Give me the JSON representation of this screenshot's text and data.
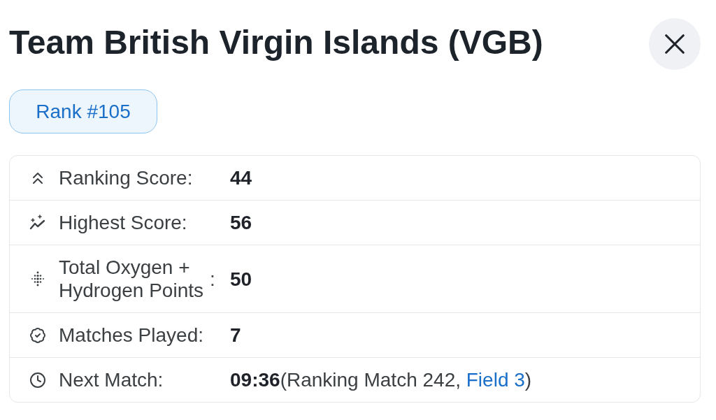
{
  "title": "Team British Virgin Islands (VGB)",
  "rank_badge": "Rank #105",
  "stats": [
    {
      "kind": "number",
      "label": "Ranking Score:",
      "value": "44"
    },
    {
      "kind": "number",
      "label": "Highest Score:",
      "value": "56"
    },
    {
      "kind": "number",
      "label": "Total Oxygen + Hydrogen Points",
      "separator": ":",
      "value": "50"
    },
    {
      "kind": "number",
      "label": "Matches Played:",
      "value": "7"
    },
    {
      "kind": "match",
      "label": "Next Match:",
      "time": "09:36",
      "detail": "(Ranking Match 242, ",
      "link": "Field 3",
      "detail_end": ")"
    }
  ]
}
